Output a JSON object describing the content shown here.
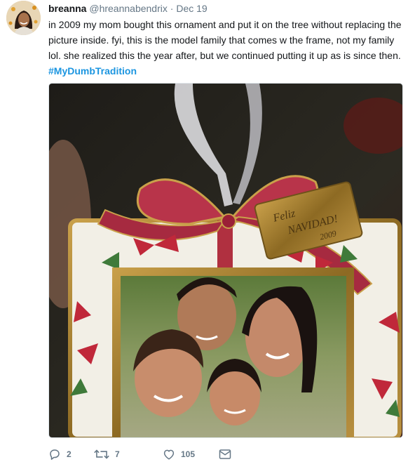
{
  "tweet": {
    "display_name": "breanna",
    "handle": "@hreannabendrix",
    "separator": "·",
    "date": "Dec 19",
    "text_body": "in 2009 my mom bought this ornament and put it on the tree without replacing the picture inside. fyi, this is the model family that comes w the frame, not my family lol. she realized this the year after, but we continued putting it up as is since then. ",
    "hashtag": "#MyDumbTradition",
    "media": {
      "ornament_line1": "Feliz",
      "ornament_line2": "NAVIDAD!",
      "ornament_year": "2009"
    }
  },
  "actions": {
    "reply_count": "2",
    "retweet_count": "7",
    "like_count": "105",
    "icons": [
      "reply-icon",
      "retweet-icon",
      "heart-icon",
      "envelope-icon"
    ]
  },
  "colors": {
    "link": "#1b95e0",
    "muted": "#657786",
    "text": "#14171a"
  }
}
